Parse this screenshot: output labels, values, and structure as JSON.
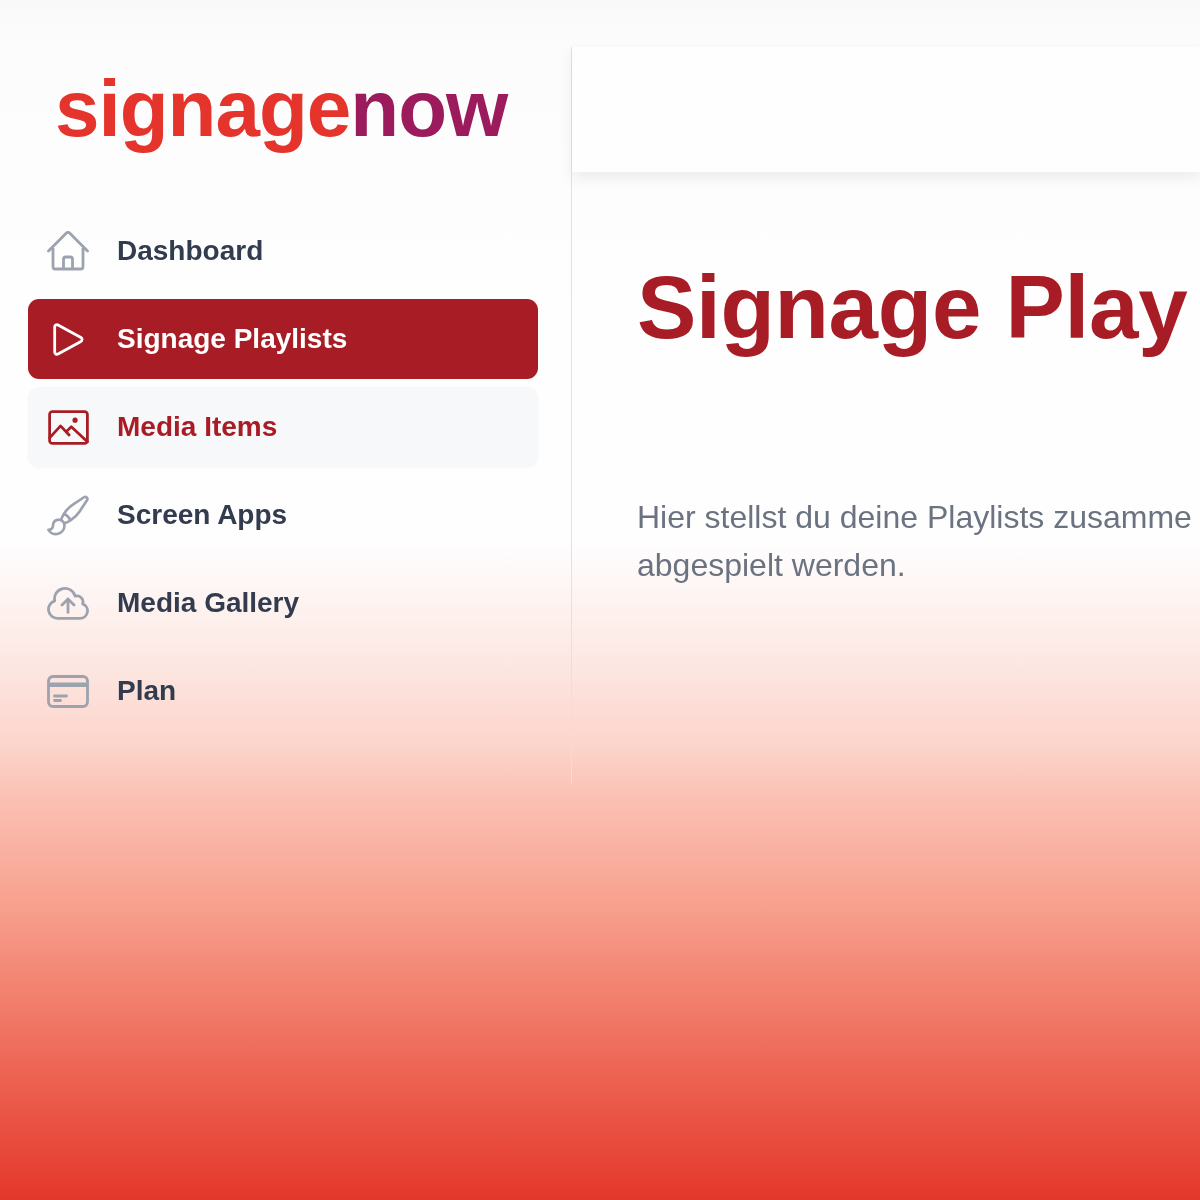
{
  "sidebar": {
    "logo": {
      "parts": [
        {
          "text": "signage",
          "color": "#e4342b"
        },
        {
          "text": "now",
          "color": "#9b1b5c"
        }
      ]
    },
    "items": [
      {
        "label": "Dashboard",
        "selected": false,
        "hovered": false
      },
      {
        "label": "Signage Playlists",
        "selected": true,
        "hovered": false
      },
      {
        "label": "Media Items",
        "selected": false,
        "hovered": true
      },
      {
        "label": "Screen Apps",
        "selected": false,
        "hovered": false
      },
      {
        "label": "Media Gallery",
        "selected": false,
        "hovered": false
      },
      {
        "label": "Plan",
        "selected": false,
        "hovered": false
      }
    ]
  },
  "content": {
    "title": "Signage Play",
    "description": [
      "Hier stellst du deine Playlists zusamme",
      "abgespielt werden."
    ]
  }
}
